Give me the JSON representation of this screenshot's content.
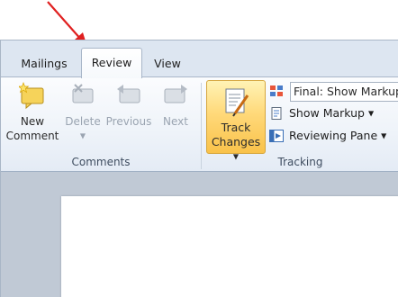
{
  "tabs": [
    {
      "label": "Mailings"
    },
    {
      "label": "Review"
    },
    {
      "label": "View"
    }
  ],
  "comments_group": {
    "label": "Comments",
    "new_comment": {
      "line1": "New",
      "line2": "Comment"
    },
    "delete": {
      "label": "Delete"
    },
    "previous": {
      "label": "Previous"
    },
    "next": {
      "label": "Next"
    }
  },
  "tracking_group": {
    "label": "Tracking",
    "track_changes": {
      "line1": "Track",
      "line2": "Changes"
    },
    "display_mode_value": "Final: Show Markup",
    "show_markup": "Show Markup",
    "reviewing_pane": "Reviewing Pane"
  },
  "colors": {
    "arrow": "#e02020",
    "active_button": "#f9c24a",
    "ribbon_bg": "#eef3f9"
  },
  "icons": [
    "new-comment-icon",
    "delete-comment-icon",
    "previous-comment-icon",
    "next-comment-icon",
    "track-changes-icon",
    "display-for-review-icon",
    "show-markup-icon",
    "reviewing-pane-icon"
  ]
}
